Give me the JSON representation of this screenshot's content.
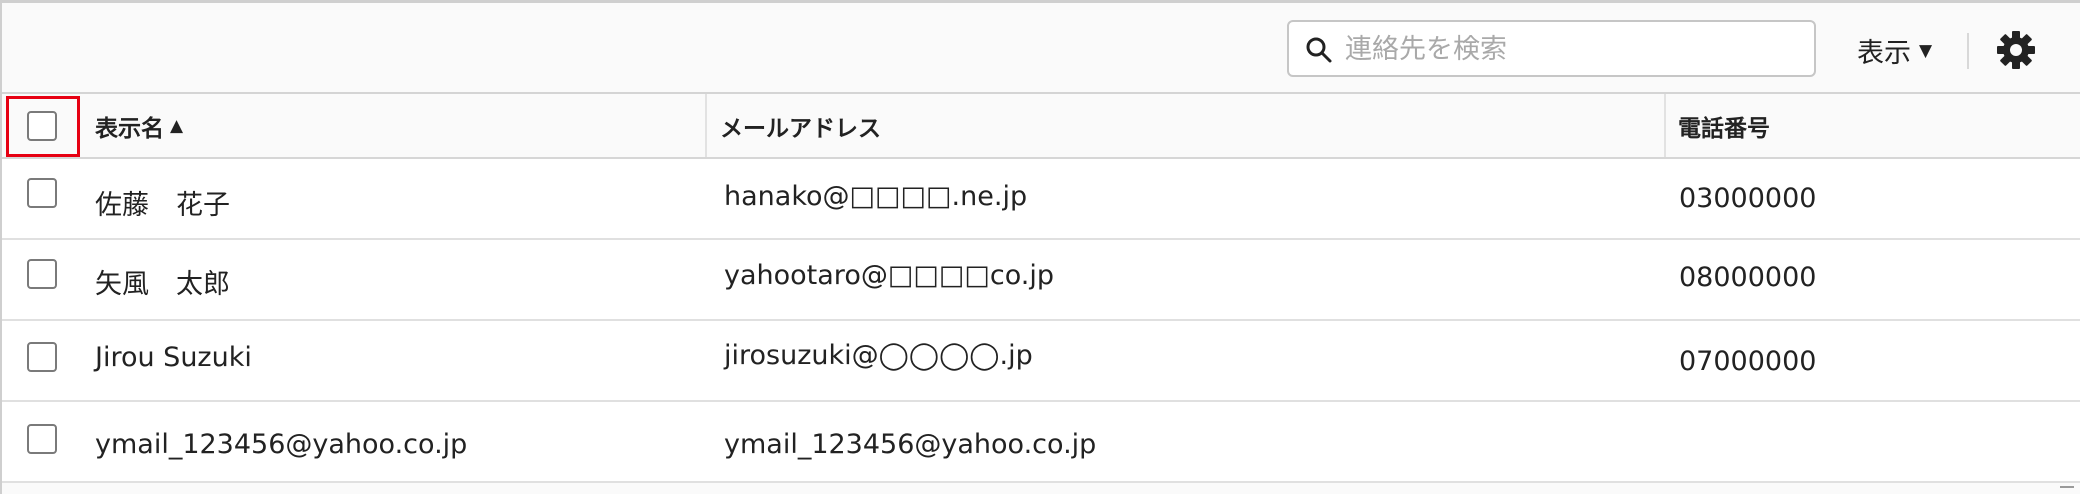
{
  "toolbar": {
    "search_placeholder": "連絡先を検索",
    "view_label": "表示",
    "view_caret": "▼"
  },
  "table": {
    "columns": {
      "name": "表示名",
      "name_sort": "▲",
      "email": "メールアドレス",
      "phone": "電話番号"
    },
    "rows": [
      {
        "name": "佐藤　花子",
        "email": "hanako@□□□□.ne.jp",
        "phone": "03000000"
      },
      {
        "name": "矢風　太郎",
        "email": "yahootaro@□□□□co.jp",
        "phone": "08000000"
      },
      {
        "name": "Jirou Suzuki",
        "email": "jirosuzuki@◯◯◯◯.jp",
        "phone": "07000000"
      },
      {
        "name": "ymail_123456@yahoo.co.jp",
        "email": "ymail_123456@yahoo.co.jp",
        "phone": ""
      }
    ]
  },
  "colors": {
    "highlight": "#e60012",
    "border": "#d6d6d6",
    "header_bg": "#fafafa"
  },
  "icons": [
    "search-icon",
    "caret-down-icon",
    "gear-icon",
    "sort-ascending-icon"
  ]
}
